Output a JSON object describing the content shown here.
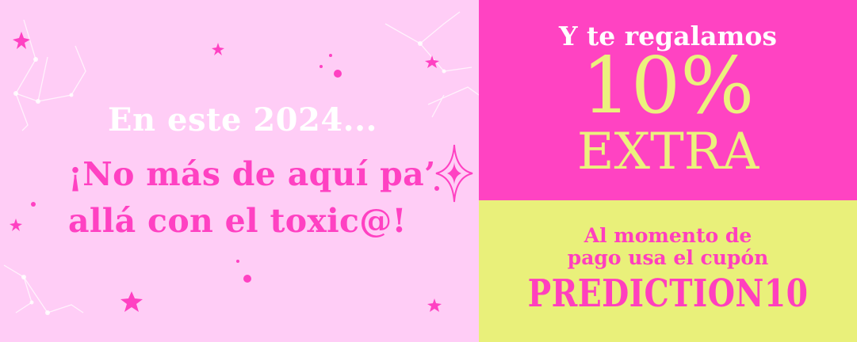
{
  "left_panel": {
    "intro": "En este 2024...",
    "line1": "¡No más de aquí pa’",
    "line2": "allá con el toxic@!",
    "colors": {
      "background": "#ffcdf6",
      "intro_text": "#ffffff",
      "main_text": "#ff41c2"
    }
  },
  "offer": {
    "intro": "Y te regalamos",
    "amount": "10%",
    "extra": "EXTRA",
    "colors": {
      "background": "#ff43c2",
      "intro_text": "#ffffff",
      "highlight": "#ebf17d"
    }
  },
  "coupon": {
    "line1": "Al momento de",
    "line2": "pago usa el cupón",
    "code": "PREDICTION10",
    "colors": {
      "background": "#e9f07a",
      "text": "#ff3fbe"
    }
  },
  "decorations": {
    "icons": [
      "star-icon",
      "sparkle-icon",
      "constellation-icon",
      "dot-icon"
    ]
  }
}
